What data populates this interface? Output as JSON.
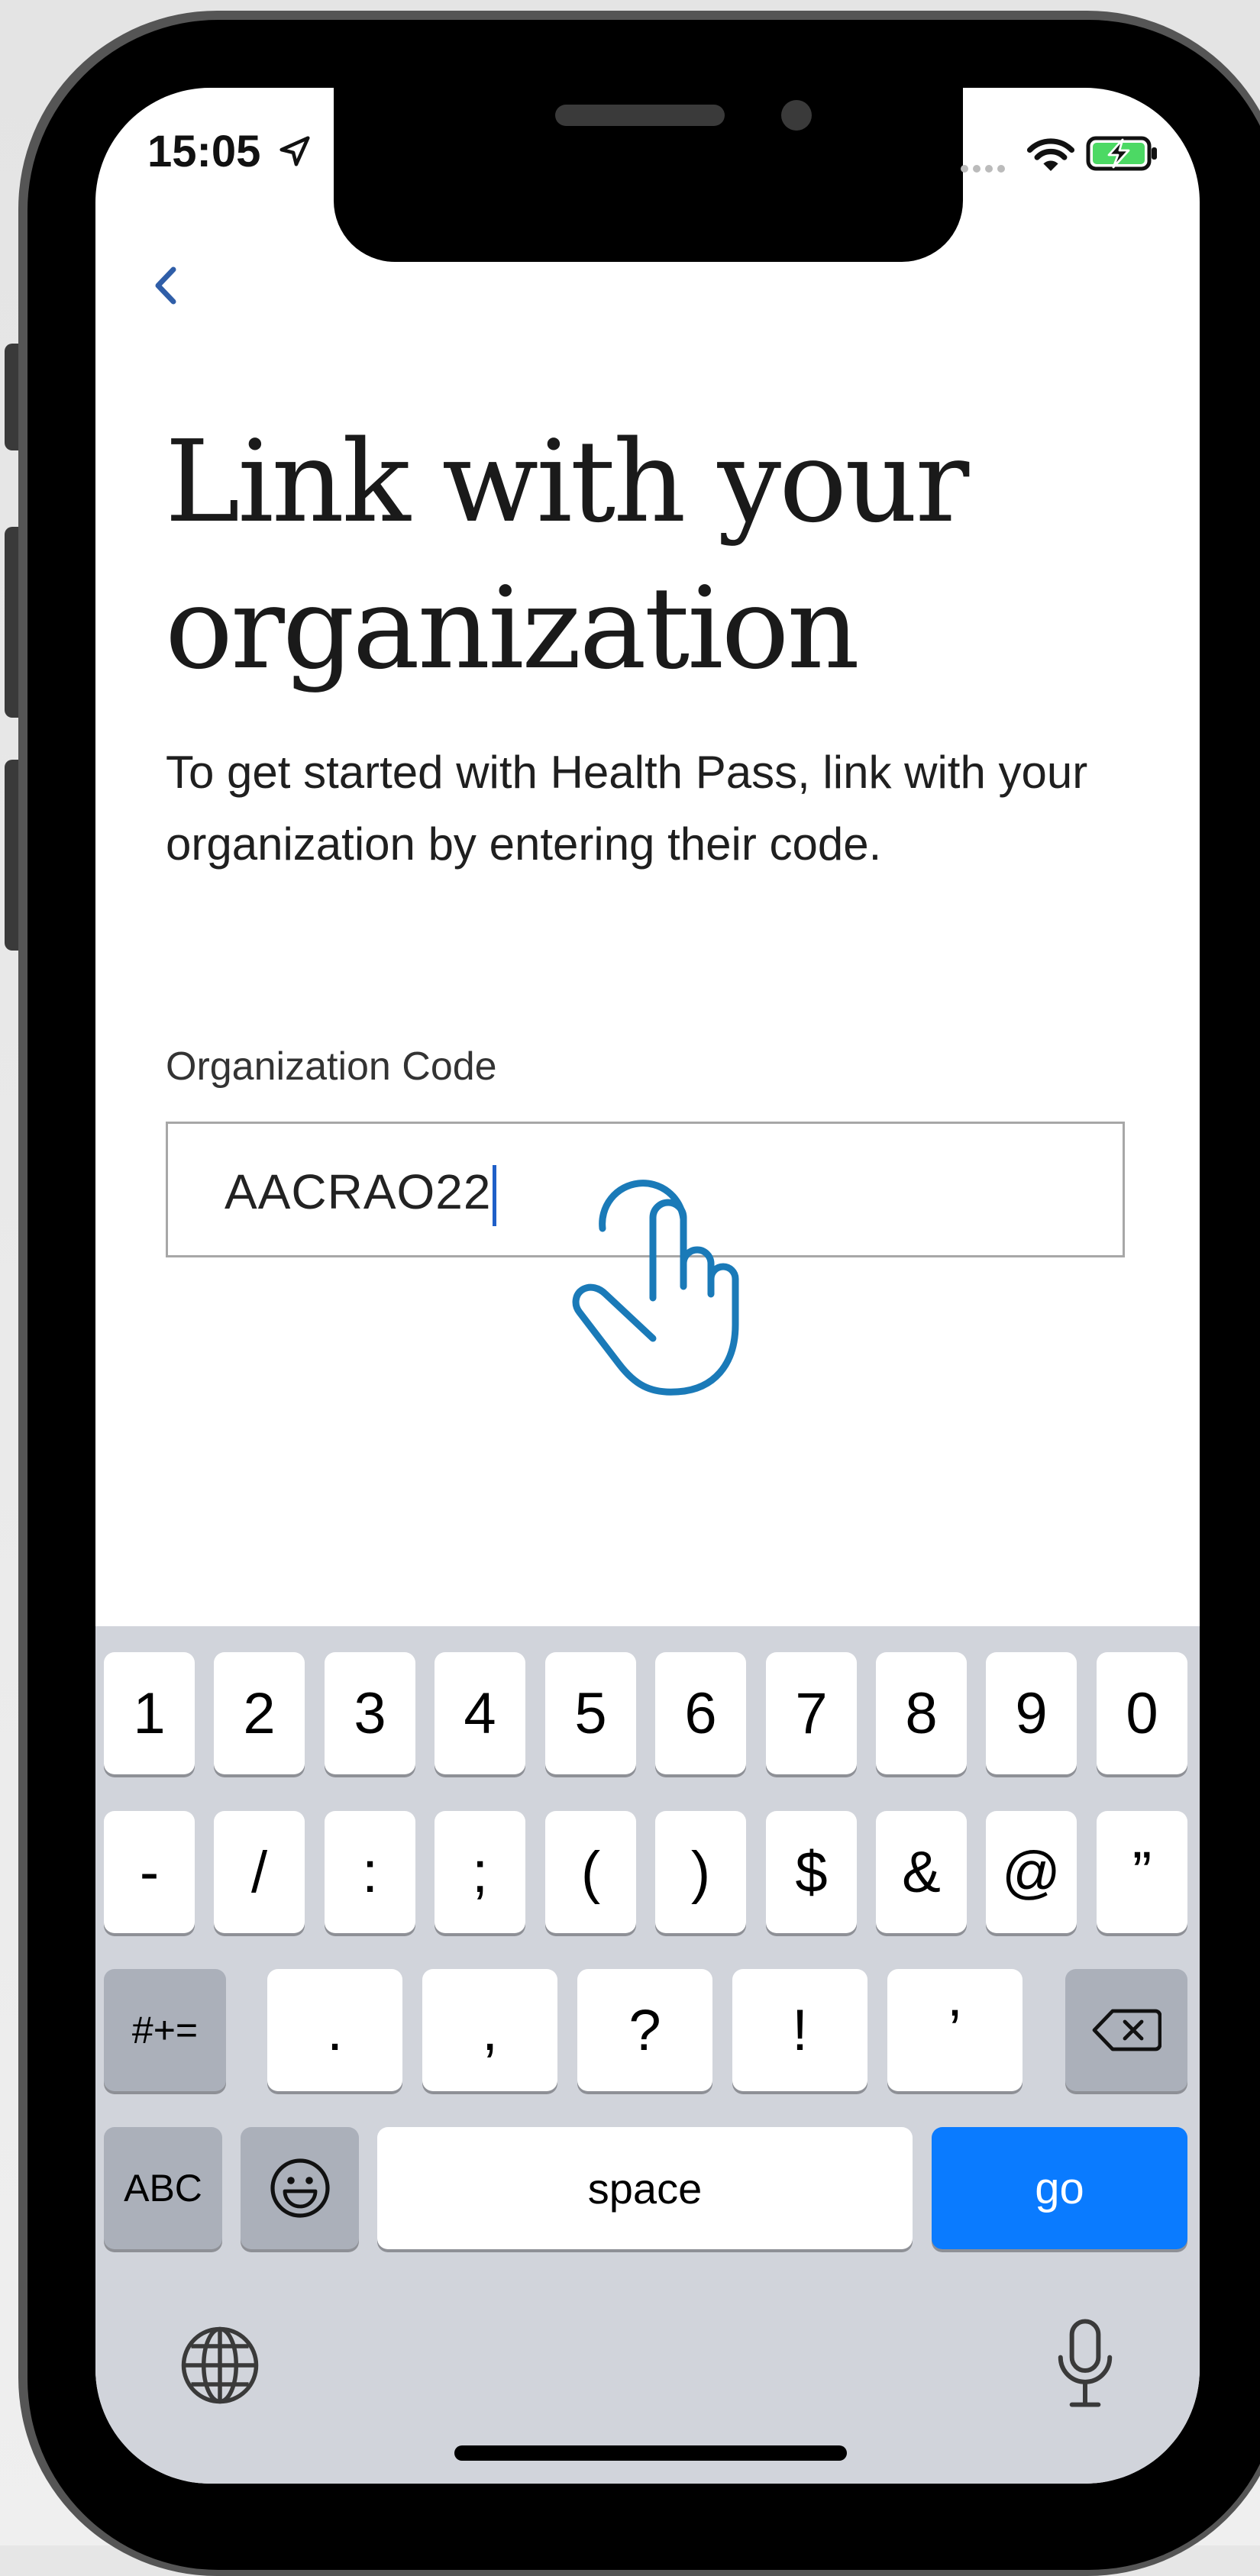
{
  "status_bar": {
    "time": "15:05"
  },
  "page": {
    "title": "Link with your organization",
    "subtitle": "To get started with Health Pass, link with your organization by entering their code.",
    "field_label": "Organization Code",
    "field_value": "AACRAO22"
  },
  "keyboard": {
    "row1": [
      "1",
      "2",
      "3",
      "4",
      "5",
      "6",
      "7",
      "8",
      "9",
      "0"
    ],
    "row2": [
      "-",
      "/",
      ":",
      ";",
      "(",
      ")",
      "$",
      "&",
      "@",
      "”"
    ],
    "row3": [
      ".",
      ",",
      "?",
      "!",
      "’"
    ],
    "symbols_toggle": "#+=",
    "abc_toggle": "ABC",
    "space_label": "space",
    "go_label": "go"
  },
  "colors": {
    "accent": "#0a7bff",
    "back_chevron": "#2f5ea8",
    "hand_icon": "#1a7ab8",
    "battery": "#4cd964"
  }
}
